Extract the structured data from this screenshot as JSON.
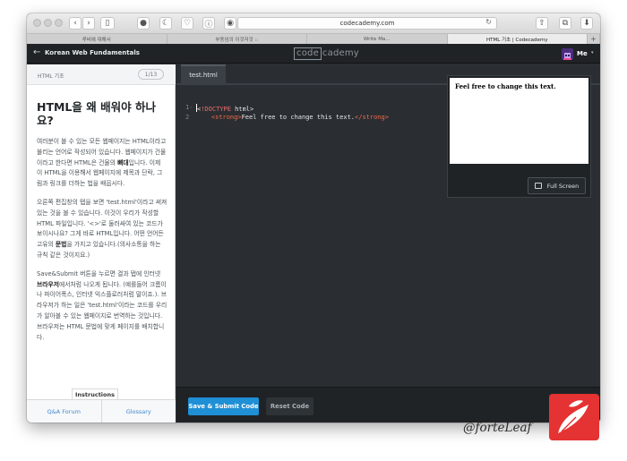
{
  "browser": {
    "url": "codecademy.com",
    "tabs": [
      {
        "label": "루비에 대해서",
        "active": false
      },
      {
        "label": "부동임의 이것저것 ::",
        "active": false
      },
      {
        "label": "Write Ma...",
        "active": false
      },
      {
        "label": "HTML 기초 | Codecademy",
        "active": true
      }
    ],
    "new_tab": "+"
  },
  "header": {
    "back_arrow": "←",
    "course_title": "Korean Web Fundamentals",
    "logo_code": "code",
    "logo_rest": "cademy",
    "user_label": "Me",
    "user_caret": "▾"
  },
  "sidebar": {
    "lesson_label": "HTML 기초",
    "progress": "1/13",
    "heading": "HTML을 왜 배워야 하나요?",
    "paragraphs": [
      {
        "before": "여러분이 볼 수 있는 모든 웹페이지는 HTML이라고 불리는 언어로 작성되어 있습니다. 웹페이지가 건물이라고 한다면 HTML은 건물의 ",
        "bold": "뼈대",
        "after": "입니다. 이제 이 HTML을 이용해서 웹페이지에 제목과 단락, 그림과 링크를 더하는 법을 배웁시다."
      },
      {
        "before": "오른쪽 편집창의 탭을 보면 'test.html'이라고 써져있는 것을 볼 수 있습니다. 이것이 우리가 작성할 HTML 파일입니다. '<>'로 둘러싸여 있는 코드가 보이시나요? 그게 바로 HTML입니다. 어떤 언어든 고유의 ",
        "bold": "문법",
        "after": "을 가지고 있습니다.(의사소통을 하는 규칙 같은 것이지요.)"
      },
      {
        "before": "Save&Submit 버튼을 누르면 결과 탭에 인터넷 ",
        "bold": "브라우저",
        "after": "에서처럼 나오게 됩니다. (예를들어 크롬이나 파이어폭스, 인터넷 익스플로러처럼 말이죠.). 브라우저가 하는 일은 'test.html'이라는 코드를 우리가 알아볼 수 있는 웹페이지로 번역하는 것입니다. 브라우저는 HTML 문법에 맞게 페이지를 배치합니다."
      }
    ],
    "instructions_tab": "Instructions",
    "links": [
      "Q&A Forum",
      "Glossary"
    ]
  },
  "editor": {
    "file_tab": "test.html",
    "lines": [
      {
        "num": "1",
        "fold": "-",
        "doctype": "!DOCTYPE",
        "rest": " html>"
      },
      {
        "num": "2",
        "indent": "    ",
        "open_tag": "<strong>",
        "text": "Feel free to change this text.",
        "close_tag": "</strong>"
      }
    ],
    "submit_label": "Save & Submit Code",
    "reset_label": "Reset Code"
  },
  "preview": {
    "text": "Feel free to change this text.",
    "fullscreen_label": "Full Screen"
  },
  "watermark": {
    "text": "@forteLeaf"
  },
  "colors": {
    "accent_blue": "#1f8fd6",
    "editor_bg": "#2a2e32",
    "tag_color": "#ef6a4a",
    "watermark_red": "#e53232"
  },
  "icons": [
    "back-icon",
    "forward-icon",
    "sidebar-icon",
    "reload-icon",
    "share-icon",
    "tabs-icon",
    "download-icon",
    "fullscreen-icon",
    "codecademy-logo",
    "avatar-icon",
    "leaf-logo"
  ]
}
